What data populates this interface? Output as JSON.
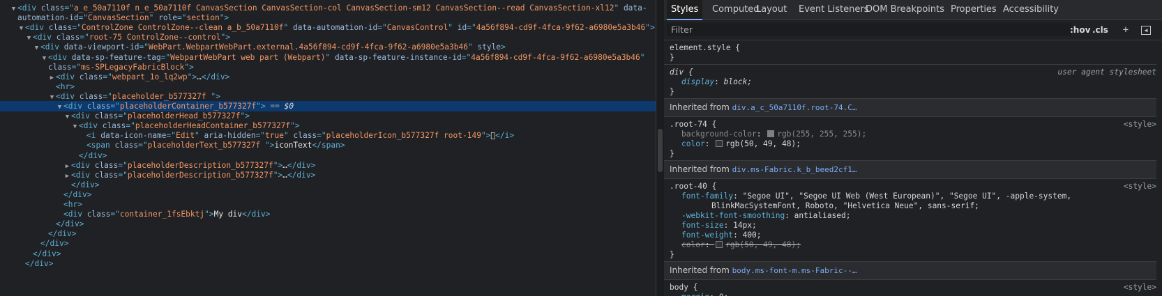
{
  "dom": {
    "lines": [
      {
        "indent": 0,
        "tw": "▼",
        "parts": [
          [
            "p",
            "<"
          ],
          [
            "t",
            "div"
          ],
          [
            "a",
            " class"
          ],
          [
            "p",
            "=\""
          ],
          [
            "v",
            "a_e_50a7110f n_e_50a7110f CanvasSection CanvasSection-col CanvasSection-sm12 CanvasSection--read CanvasSection-xl12"
          ],
          [
            "p",
            "\""
          ],
          [
            "a",
            " data-"
          ]
        ]
      },
      {
        "indent": 0,
        "tw": "",
        "parts": [
          [
            "a",
            "automation-id"
          ],
          [
            "p",
            "=\""
          ],
          [
            "v",
            "CanvasSection"
          ],
          [
            "p",
            "\""
          ],
          [
            "a",
            " role"
          ],
          [
            "p",
            "=\""
          ],
          [
            "v",
            "section"
          ],
          [
            "p",
            "\">"
          ]
        ]
      },
      {
        "indent": 1,
        "tw": "▼",
        "parts": [
          [
            "p",
            "<"
          ],
          [
            "t",
            "div"
          ],
          [
            "a",
            " class"
          ],
          [
            "p",
            "=\""
          ],
          [
            "v",
            "ControlZone ControlZone--clean a_b_50a7110f"
          ],
          [
            "p",
            "\""
          ],
          [
            "a",
            " data-automation-id"
          ],
          [
            "p",
            "=\""
          ],
          [
            "v",
            "CanvasControl"
          ],
          [
            "p",
            "\""
          ],
          [
            "a",
            " id"
          ],
          [
            "p",
            "=\""
          ],
          [
            "v",
            "4a56f894-cd9f-4fca-9f62-a6980e5a3b46"
          ],
          [
            "p",
            "\">"
          ]
        ]
      },
      {
        "indent": 2,
        "tw": "▼",
        "parts": [
          [
            "p",
            "<"
          ],
          [
            "t",
            "div"
          ],
          [
            "a",
            " class"
          ],
          [
            "p",
            "=\""
          ],
          [
            "v",
            "root-75 ControlZone--control"
          ],
          [
            "p",
            "\">"
          ]
        ]
      },
      {
        "indent": 3,
        "tw": "▼",
        "parts": [
          [
            "p",
            "<"
          ],
          [
            "t",
            "div"
          ],
          [
            "a",
            " data-viewport-id"
          ],
          [
            "p",
            "=\""
          ],
          [
            "v",
            "WebPart.WebpartWebPart.external.4a56f894-cd9f-4fca-9f62-a6980e5a3b46"
          ],
          [
            "p",
            "\""
          ],
          [
            "a",
            " style"
          ],
          [
            "p",
            ">"
          ]
        ]
      },
      {
        "indent": 4,
        "tw": "▼",
        "parts": [
          [
            "p",
            "<"
          ],
          [
            "t",
            "div"
          ],
          [
            "a",
            " data-sp-feature-tag"
          ],
          [
            "p",
            "=\""
          ],
          [
            "v",
            "WebpartWebPart web part (Webpart)"
          ],
          [
            "p",
            "\""
          ],
          [
            "a",
            " data-sp-feature-instance-id"
          ],
          [
            "p",
            "=\""
          ],
          [
            "v",
            "4a56f894-cd9f-4fca-9f62-a6980e5a3b46"
          ],
          [
            "p",
            "\""
          ]
        ]
      },
      {
        "indent": 4,
        "tw": "",
        "parts": [
          [
            "a",
            "class"
          ],
          [
            "p",
            "=\""
          ],
          [
            "v",
            "ms-SPLegacyFabricBlock"
          ],
          [
            "p",
            "\">"
          ]
        ]
      },
      {
        "indent": 5,
        "tw": "▶",
        "parts": [
          [
            "p",
            "<"
          ],
          [
            "t",
            "div"
          ],
          [
            "a",
            " class"
          ],
          [
            "p",
            "=\""
          ],
          [
            "v",
            "webpart_1o_lq2wp"
          ],
          [
            "p",
            "\">"
          ],
          [
            "ell",
            "…"
          ],
          [
            "p",
            "</"
          ],
          [
            "t",
            "div"
          ],
          [
            "p",
            ">"
          ]
        ]
      },
      {
        "indent": 5,
        "tw": "",
        "parts": [
          [
            "p",
            "<"
          ],
          [
            "t",
            "hr"
          ],
          [
            "p",
            ">"
          ]
        ]
      },
      {
        "indent": 5,
        "tw": "▼",
        "parts": [
          [
            "p",
            "<"
          ],
          [
            "t",
            "div"
          ],
          [
            "a",
            " class"
          ],
          [
            "p",
            "=\""
          ],
          [
            "v",
            "placeholder_b577327f "
          ],
          [
            "p",
            "\">"
          ]
        ]
      },
      {
        "indent": 6,
        "tw": "▼",
        "selected": true,
        "parts": [
          [
            "p",
            "<"
          ],
          [
            "t",
            "div"
          ],
          [
            "a",
            " class"
          ],
          [
            "p",
            "=\""
          ],
          [
            "v",
            "placeholderContainer_b577327f"
          ],
          [
            "p",
            "\">"
          ],
          [
            "eq",
            " == "
          ],
          [
            "ref",
            "$0"
          ]
        ]
      },
      {
        "indent": 7,
        "tw": "▼",
        "parts": [
          [
            "p",
            "<"
          ],
          [
            "t",
            "div"
          ],
          [
            "a",
            " class"
          ],
          [
            "p",
            "=\""
          ],
          [
            "v",
            "placeholderHead_b577327f"
          ],
          [
            "p",
            "\">"
          ]
        ]
      },
      {
        "indent": 8,
        "tw": "▼",
        "parts": [
          [
            "p",
            "<"
          ],
          [
            "t",
            "div"
          ],
          [
            "a",
            " class"
          ],
          [
            "p",
            "=\""
          ],
          [
            "v",
            "placeholderHeadContainer_b577327f"
          ],
          [
            "p",
            "\">"
          ]
        ]
      },
      {
        "indent": 9,
        "tw": "",
        "parts": [
          [
            "p",
            "<"
          ],
          [
            "t",
            "i"
          ],
          [
            "a",
            " data-icon-name"
          ],
          [
            "p",
            "=\""
          ],
          [
            "v",
            "Edit"
          ],
          [
            "p",
            "\""
          ],
          [
            "a",
            " aria-hidden"
          ],
          [
            "p",
            "=\""
          ],
          [
            "v",
            "true"
          ],
          [
            "p",
            "\""
          ],
          [
            "a",
            " class"
          ],
          [
            "p",
            "=\""
          ],
          [
            "v",
            "placeholderIcon_b577327f root-149"
          ],
          [
            "p",
            "\">"
          ],
          [
            "txt",
            ""
          ],
          [
            "p",
            "</"
          ],
          [
            "t",
            "i"
          ],
          [
            "p",
            ">"
          ]
        ]
      },
      {
        "indent": 9,
        "tw": "",
        "parts": [
          [
            "p",
            "<"
          ],
          [
            "t",
            "span"
          ],
          [
            "a",
            " class"
          ],
          [
            "p",
            "=\""
          ],
          [
            "v",
            "placeholderText_b577327f "
          ],
          [
            "p",
            "\">"
          ],
          [
            "txt",
            "iconText"
          ],
          [
            "p",
            "</"
          ],
          [
            "t",
            "span"
          ],
          [
            "p",
            ">"
          ]
        ]
      },
      {
        "indent": 8,
        "tw": "",
        "parts": [
          [
            "p",
            "</"
          ],
          [
            "t",
            "div"
          ],
          [
            "p",
            ">"
          ]
        ]
      },
      {
        "indent": 7,
        "tw": "▶",
        "parts": [
          [
            "p",
            "<"
          ],
          [
            "t",
            "div"
          ],
          [
            "a",
            " class"
          ],
          [
            "p",
            "=\""
          ],
          [
            "v",
            "placeholderDescription_b577327f"
          ],
          [
            "p",
            "\">"
          ],
          [
            "ell",
            "…"
          ],
          [
            "p",
            "</"
          ],
          [
            "t",
            "div"
          ],
          [
            "p",
            ">"
          ]
        ]
      },
      {
        "indent": 7,
        "tw": "▶",
        "parts": [
          [
            "p",
            "<"
          ],
          [
            "t",
            "div"
          ],
          [
            "a",
            " class"
          ],
          [
            "p",
            "=\""
          ],
          [
            "v",
            "placeholderDescription_b577327f"
          ],
          [
            "p",
            "\">"
          ],
          [
            "ell",
            "…"
          ],
          [
            "p",
            "</"
          ],
          [
            "t",
            "div"
          ],
          [
            "p",
            ">"
          ]
        ]
      },
      {
        "indent": 7,
        "tw": "",
        "parts": [
          [
            "p",
            "</"
          ],
          [
            "t",
            "div"
          ],
          [
            "p",
            ">"
          ]
        ]
      },
      {
        "indent": 6,
        "tw": "",
        "parts": [
          [
            "p",
            "</"
          ],
          [
            "t",
            "div"
          ],
          [
            "p",
            ">"
          ]
        ]
      },
      {
        "indent": 6,
        "tw": "",
        "parts": [
          [
            "p",
            "<"
          ],
          [
            "t",
            "hr"
          ],
          [
            "p",
            ">"
          ]
        ]
      },
      {
        "indent": 6,
        "tw": "",
        "parts": [
          [
            "p",
            "<"
          ],
          [
            "t",
            "div"
          ],
          [
            "a",
            " class"
          ],
          [
            "p",
            "=\""
          ],
          [
            "v",
            "container_1fsEbktj"
          ],
          [
            "p",
            "\">"
          ],
          [
            "txt",
            "My div"
          ],
          [
            "p",
            "</"
          ],
          [
            "t",
            "div"
          ],
          [
            "p",
            ">"
          ]
        ]
      },
      {
        "indent": 5,
        "tw": "",
        "parts": [
          [
            "p",
            "</"
          ],
          [
            "t",
            "div"
          ],
          [
            "p",
            ">"
          ]
        ]
      },
      {
        "indent": 4,
        "tw": "",
        "parts": [
          [
            "p",
            "</"
          ],
          [
            "t",
            "div"
          ],
          [
            "p",
            ">"
          ]
        ]
      },
      {
        "indent": 3,
        "tw": "",
        "parts": [
          [
            "p",
            "</"
          ],
          [
            "t",
            "div"
          ],
          [
            "p",
            ">"
          ]
        ]
      },
      {
        "indent": 2,
        "tw": "",
        "parts": [
          [
            "p",
            "</"
          ],
          [
            "t",
            "div"
          ],
          [
            "p",
            ">"
          ]
        ]
      },
      {
        "indent": 1,
        "tw": "",
        "parts": [
          [
            "p",
            "</"
          ],
          [
            "t",
            "div"
          ],
          [
            "p",
            ">"
          ]
        ]
      }
    ]
  },
  "tabs": [
    {
      "label": "Styles",
      "active": true
    },
    {
      "label": "Computed"
    },
    {
      "label": "Layout"
    },
    {
      "label": "Event Listeners"
    },
    {
      "label": "DOM Breakpoints"
    },
    {
      "label": "Properties"
    },
    {
      "label": "Accessibility"
    }
  ],
  "filter": {
    "placeholder": "Filter",
    "hov_label": ":hov",
    "cls_label": ".cls",
    "new_rule_icon": "plus-icon",
    "sidebar_icon": "toggle-sidebar-icon"
  },
  "rules": [
    {
      "kind": "rule",
      "selector": "element.style {",
      "origin": "",
      "decls": [],
      "close": "}"
    },
    {
      "kind": "rule",
      "selector": "div {",
      "selector_italic": true,
      "origin": "user agent stylesheet",
      "decls": [
        {
          "name": "display",
          "value": "block;",
          "italic": true
        }
      ],
      "close": "}"
    },
    {
      "kind": "inherited",
      "prefix": "Inherited from ",
      "link": "div.a_c_50a7110f.root-74.C…"
    },
    {
      "kind": "rule",
      "selector": ".root-74 {",
      "origin": "<style>",
      "decls": [
        {
          "name": "background-color",
          "value": "rgb(255, 255, 255);",
          "swatch": "#808080",
          "dim": true
        },
        {
          "name": "color",
          "value": "rgb(50, 49, 48);",
          "swatch": "#323130"
        }
      ],
      "close": "}"
    },
    {
      "kind": "inherited",
      "prefix": "Inherited from ",
      "link": "div.ms-Fabric.k_b_beed2cf1…"
    },
    {
      "kind": "rule",
      "selector": ".root-40 {",
      "origin": "<style>",
      "decls": [
        {
          "name": "font-family",
          "value": "\"Segoe UI\", \"Segoe UI Web (West European)\", \"Segoe UI\", -apple-system,"
        },
        {
          "cont": true,
          "value": "BlinkMacSystemFont, Roboto, \"Helvetica Neue\", sans-serif;"
        },
        {
          "name": "-webkit-font-smoothing",
          "value": "antialiased;"
        },
        {
          "name": "font-size",
          "value": "14px;"
        },
        {
          "name": "font-weight",
          "value": "400;"
        },
        {
          "name": "color",
          "value": "rgb(50, 49, 48);",
          "swatch": "#323130",
          "struck": true
        }
      ],
      "close": "}"
    },
    {
      "kind": "inherited",
      "prefix": "Inherited from ",
      "link": "body.ms-font-m.ms-Fabric--…"
    },
    {
      "kind": "rule",
      "selector": "body {",
      "origin": "<style>",
      "decls": [
        {
          "name": "margin",
          "value": "0;"
        }
      ],
      "close": ""
    }
  ],
  "colors": {
    "selected_row": "#0d3a6e",
    "tab_underline": "#7cacf8",
    "link": "#7cacf8"
  }
}
